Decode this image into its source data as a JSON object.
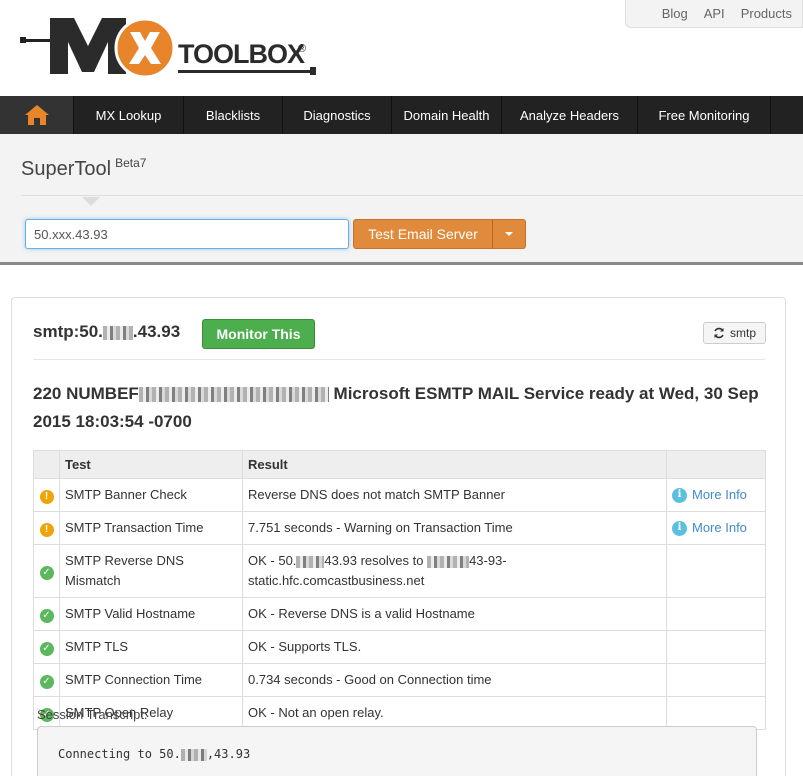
{
  "header": {
    "logo_text": "MXTOOLBOX",
    "logo_reg": "®",
    "top_links": [
      "Blog",
      "API",
      "Products"
    ]
  },
  "nav": {
    "items": [
      "MX Lookup",
      "Blacklists",
      "Diagnostics",
      "Domain Health",
      "Analyze Headers",
      "Free Monitoring"
    ]
  },
  "supertool": {
    "title": "SuperTool",
    "badge": "Beta7",
    "input_value": "50.xxx.43.93",
    "button_label": "Test Email Server"
  },
  "result": {
    "host_prefix": "smtp:50.",
    "host_suffix": ".43.93",
    "monitor_label": "Monitor This",
    "smtp_label": "smtp",
    "banner_start": "220 NUMBEF",
    "banner_end": "Microsoft ESMTP MAIL Service ready at Wed, 30 Sep 2015 18:03:54 -0700",
    "table": {
      "headers": [
        "Test",
        "Result"
      ],
      "rows": [
        {
          "status": "warning",
          "test": "SMTP Banner Check",
          "result": "Reverse DNS does not match SMTP Banner",
          "info": "More Info"
        },
        {
          "status": "warning",
          "test": "SMTP Transaction Time",
          "result": "7.751 seconds - Warning on Transaction Time",
          "info": "More Info"
        },
        {
          "status": "ok",
          "test": "SMTP Reverse DNS Mismatch",
          "result_a": "OK - 50.",
          "result_b": "43.93 resolves to",
          "result_c": "43-93-static.hfc.comcastbusiness.net",
          "info": ""
        },
        {
          "status": "ok",
          "test": "SMTP Valid Hostname",
          "result": "OK - Reverse DNS is a valid Hostname",
          "info": ""
        },
        {
          "status": "ok",
          "test": "SMTP TLS",
          "result": "OK - Supports TLS.",
          "info": ""
        },
        {
          "status": "ok",
          "test": "SMTP Connection Time",
          "result": "0.734 seconds - Good on Connection time",
          "info": ""
        },
        {
          "status": "ok",
          "test": "SMTP Open Relay",
          "result": "OK - Not an open relay.",
          "info": ""
        }
      ]
    },
    "session_label": "Session Transcript:",
    "transcript_prefix": "Connecting to 50.",
    "transcript_suffix": ",43.93"
  },
  "colors": {
    "nav_bg": "#222222",
    "accent_orange": "#e08a3c",
    "monitor_green": "#4cae4c",
    "warning": "#f0a30a",
    "ok": "#5cb85c",
    "link": "#428bca"
  }
}
